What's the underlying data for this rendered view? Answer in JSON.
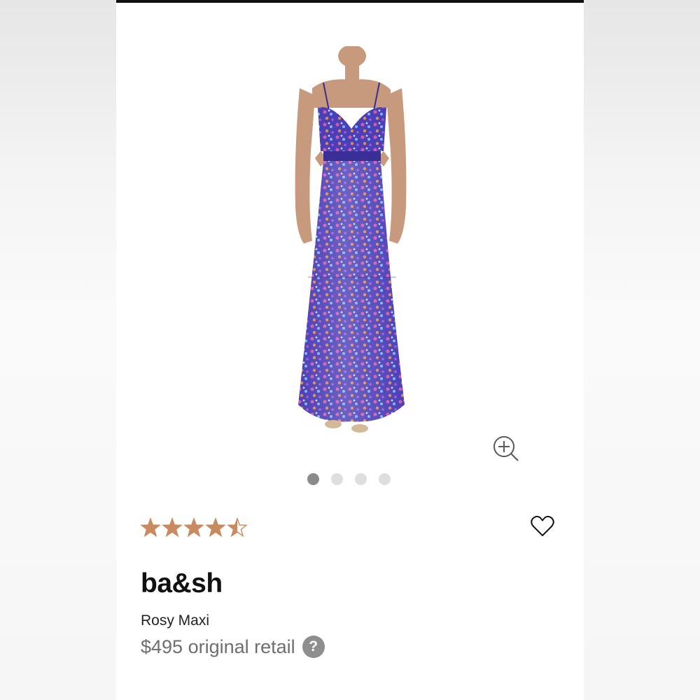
{
  "gallery": {
    "zoom_icon": "zoom-in-icon",
    "slides": [
      {
        "active": true
      },
      {
        "active": false
      },
      {
        "active": false
      },
      {
        "active": false
      }
    ]
  },
  "rating": {
    "value": 4.5,
    "max": 5,
    "star_color": "#c98a5f",
    "star_icon": "star-icon"
  },
  "favorite": {
    "icon": "heart-icon"
  },
  "product": {
    "brand": "ba&sh",
    "name": "Rosy Maxi",
    "price": "$495 original retail",
    "help_icon_text": "?"
  },
  "colors": {
    "accent": "#c98a5f",
    "dot_active": "#8a8a8a",
    "dot_inactive": "#dedede",
    "text_price": "#6e6e6e",
    "top_rule": "#111111"
  }
}
